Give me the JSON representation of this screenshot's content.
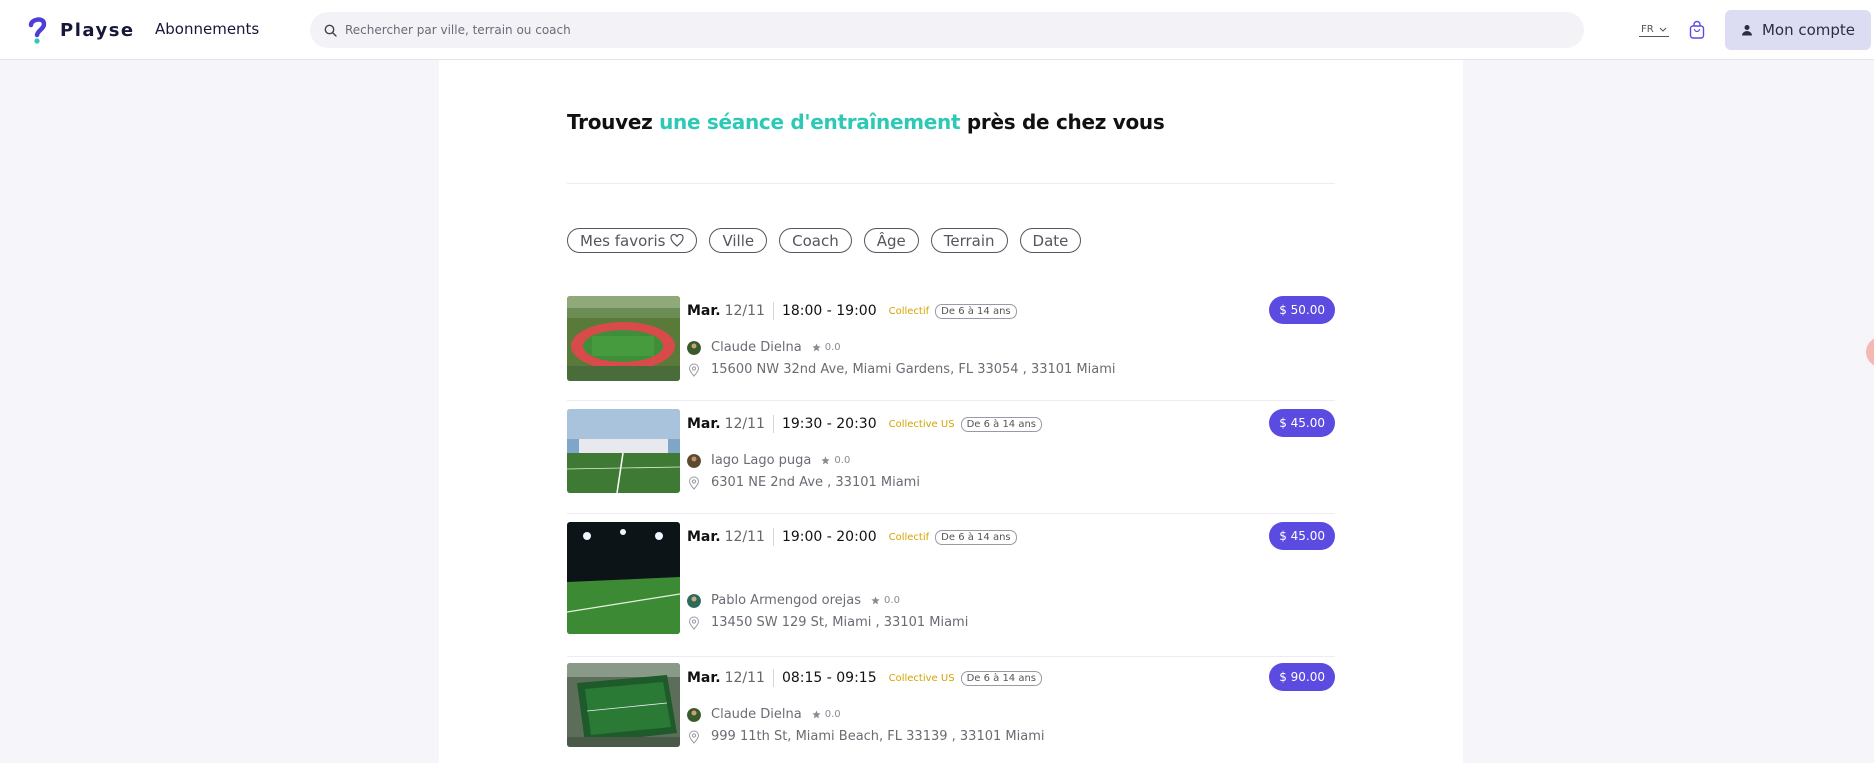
{
  "header": {
    "brand": "Playse",
    "nav_subscriptions": "Abonnements",
    "search_placeholder": "Rechercher par ville, terrain ou coach",
    "language": "FR",
    "account_label": "Mon compte",
    "icons": [
      "logo-mark",
      "search-icon",
      "chevron-down-icon",
      "cart-icon",
      "user-icon"
    ]
  },
  "main": {
    "headline_before": "Trouvez",
    "headline_accent": "une séance d'entraînement",
    "headline_after": "près de chez vous",
    "accent_color": "#2ec9b6",
    "filters": [
      "Mes favoris",
      "Ville",
      "Coach",
      "Âge",
      "Terrain",
      "Date"
    ]
  },
  "sessions": [
    {
      "day": "Mar.",
      "date": "12/11",
      "time": "18:00 - 19:00",
      "type": "Collectif",
      "age": "De 6 à 14 ans",
      "price": "$ 50.00",
      "coach": "Claude Dielna",
      "rating": "0.0",
      "address": "15600 NW 32nd Ave, Miami Gardens, FL 33054 , 33101 Miami"
    },
    {
      "day": "Mar.",
      "date": "12/11",
      "time": "19:30 - 20:30",
      "type": "Collective US",
      "age": "De 6 à 14 ans",
      "price": "$ 45.00",
      "coach": "Iago Lago puga",
      "rating": "0.0",
      "address": "6301 NE 2nd Ave , 33101 Miami"
    },
    {
      "day": "Mar.",
      "date": "12/11",
      "time": "19:00 - 20:00",
      "type": "Collectif",
      "age": "De 6 à 14 ans",
      "price": "$ 45.00",
      "coach": "Pablo Armengod orejas",
      "rating": "0.0",
      "address": "13450 SW 129 St, Miami , 33101 Miami"
    },
    {
      "day": "Mar.",
      "date": "12/11",
      "time": "08:15 - 09:15",
      "type": "Collective US",
      "age": "De 6 à 14 ans",
      "price": "$ 90.00",
      "coach": "Claude Dielna",
      "rating": "0.0",
      "address": "999 11th St, Miami Beach, FL 33139 , 33101 Miami"
    }
  ],
  "colors": {
    "price_badge": "#5b4be0",
    "type_tag": "#d4a400",
    "account_bg": "#dcdcf2"
  }
}
